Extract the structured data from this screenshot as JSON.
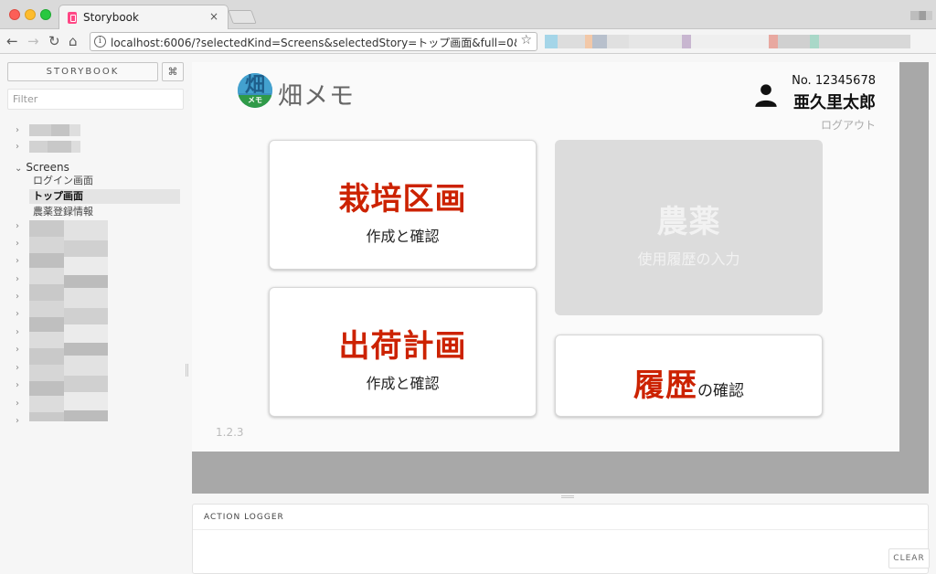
{
  "browser": {
    "tab_title": "Storybook",
    "tab_close": "×",
    "url": "localhost:6006/?selectedKind=Screens&selectedStory=トップ画面&full=0&down=1...",
    "icons": [
      "back-arrow-icon",
      "forward-arrow-icon",
      "reload-icon",
      "home-icon",
      "info-icon",
      "bookmark-star-icon"
    ]
  },
  "storybook": {
    "brand": "STORYBOOK",
    "shortcuts_label": "⌘",
    "filter_placeholder": "Filter",
    "kinds": [
      {
        "label": "Screens",
        "expanded": true,
        "stories": [
          {
            "label": "ログイン画面",
            "selected": false
          },
          {
            "label": "トップ画面",
            "selected": true
          },
          {
            "label": "農薬登録情報",
            "selected": false
          }
        ]
      }
    ],
    "panel_tab": "ACTION LOGGER",
    "clear_label": "CLEAR"
  },
  "app": {
    "logo_char": "畑",
    "logo_sub": "メモ",
    "name": "畑メモ",
    "user_no": "No. 12345678",
    "user_name": "亜久里太郎",
    "logout": "ログアウト",
    "version": "1.2.3",
    "cards": {
      "plots": {
        "title": "栽培区画",
        "sub": "作成と確認",
        "enabled": true
      },
      "shipping": {
        "title": "出荷計画",
        "sub": "作成と確認",
        "enabled": true
      },
      "pesticide": {
        "title": "農薬",
        "sub": "使用履歴の入力",
        "enabled": false
      },
      "history": {
        "title": "履歴",
        "sub": "の確認",
        "enabled": true
      }
    }
  },
  "colors": {
    "accent_red": "#cc2200",
    "disabled_card": "#dcdcdc",
    "preview_frame": "#a8a8a8"
  }
}
